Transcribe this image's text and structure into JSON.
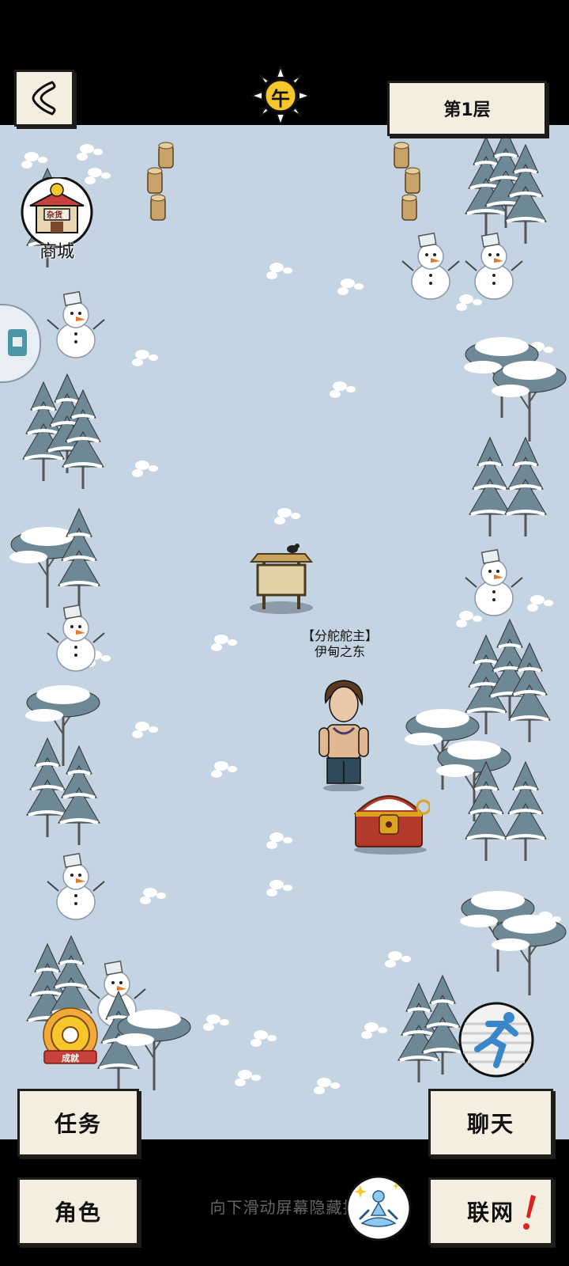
{
  "header": {
    "time_glyph": "午",
    "floor_label": "第1层",
    "back_icon": "back-chevron-icon"
  },
  "shop": {
    "label": "商城",
    "sign": "杂货",
    "icon": "shop-building-icon"
  },
  "npc": {
    "title": "【分舵舵主】",
    "name": "伊甸之东"
  },
  "achievement": {
    "label": "成就",
    "icon": "achievement-medal-icon"
  },
  "run": {
    "icon": "running-figure-icon"
  },
  "buttons": {
    "task": "任务",
    "chat": "聊天",
    "role": "角色",
    "network": "联网",
    "meditate_icon": "meditation-figure-icon",
    "alert_icon": "exclamation-icon"
  },
  "hint_text": "向下滑动屏幕隐藏技",
  "colors": {
    "snow": "#c5d4e2",
    "paper": "#f3eee0",
    "ink": "#1d1d1d",
    "chest_red": "#b23a2a",
    "chest_gold": "#d9a521"
  }
}
